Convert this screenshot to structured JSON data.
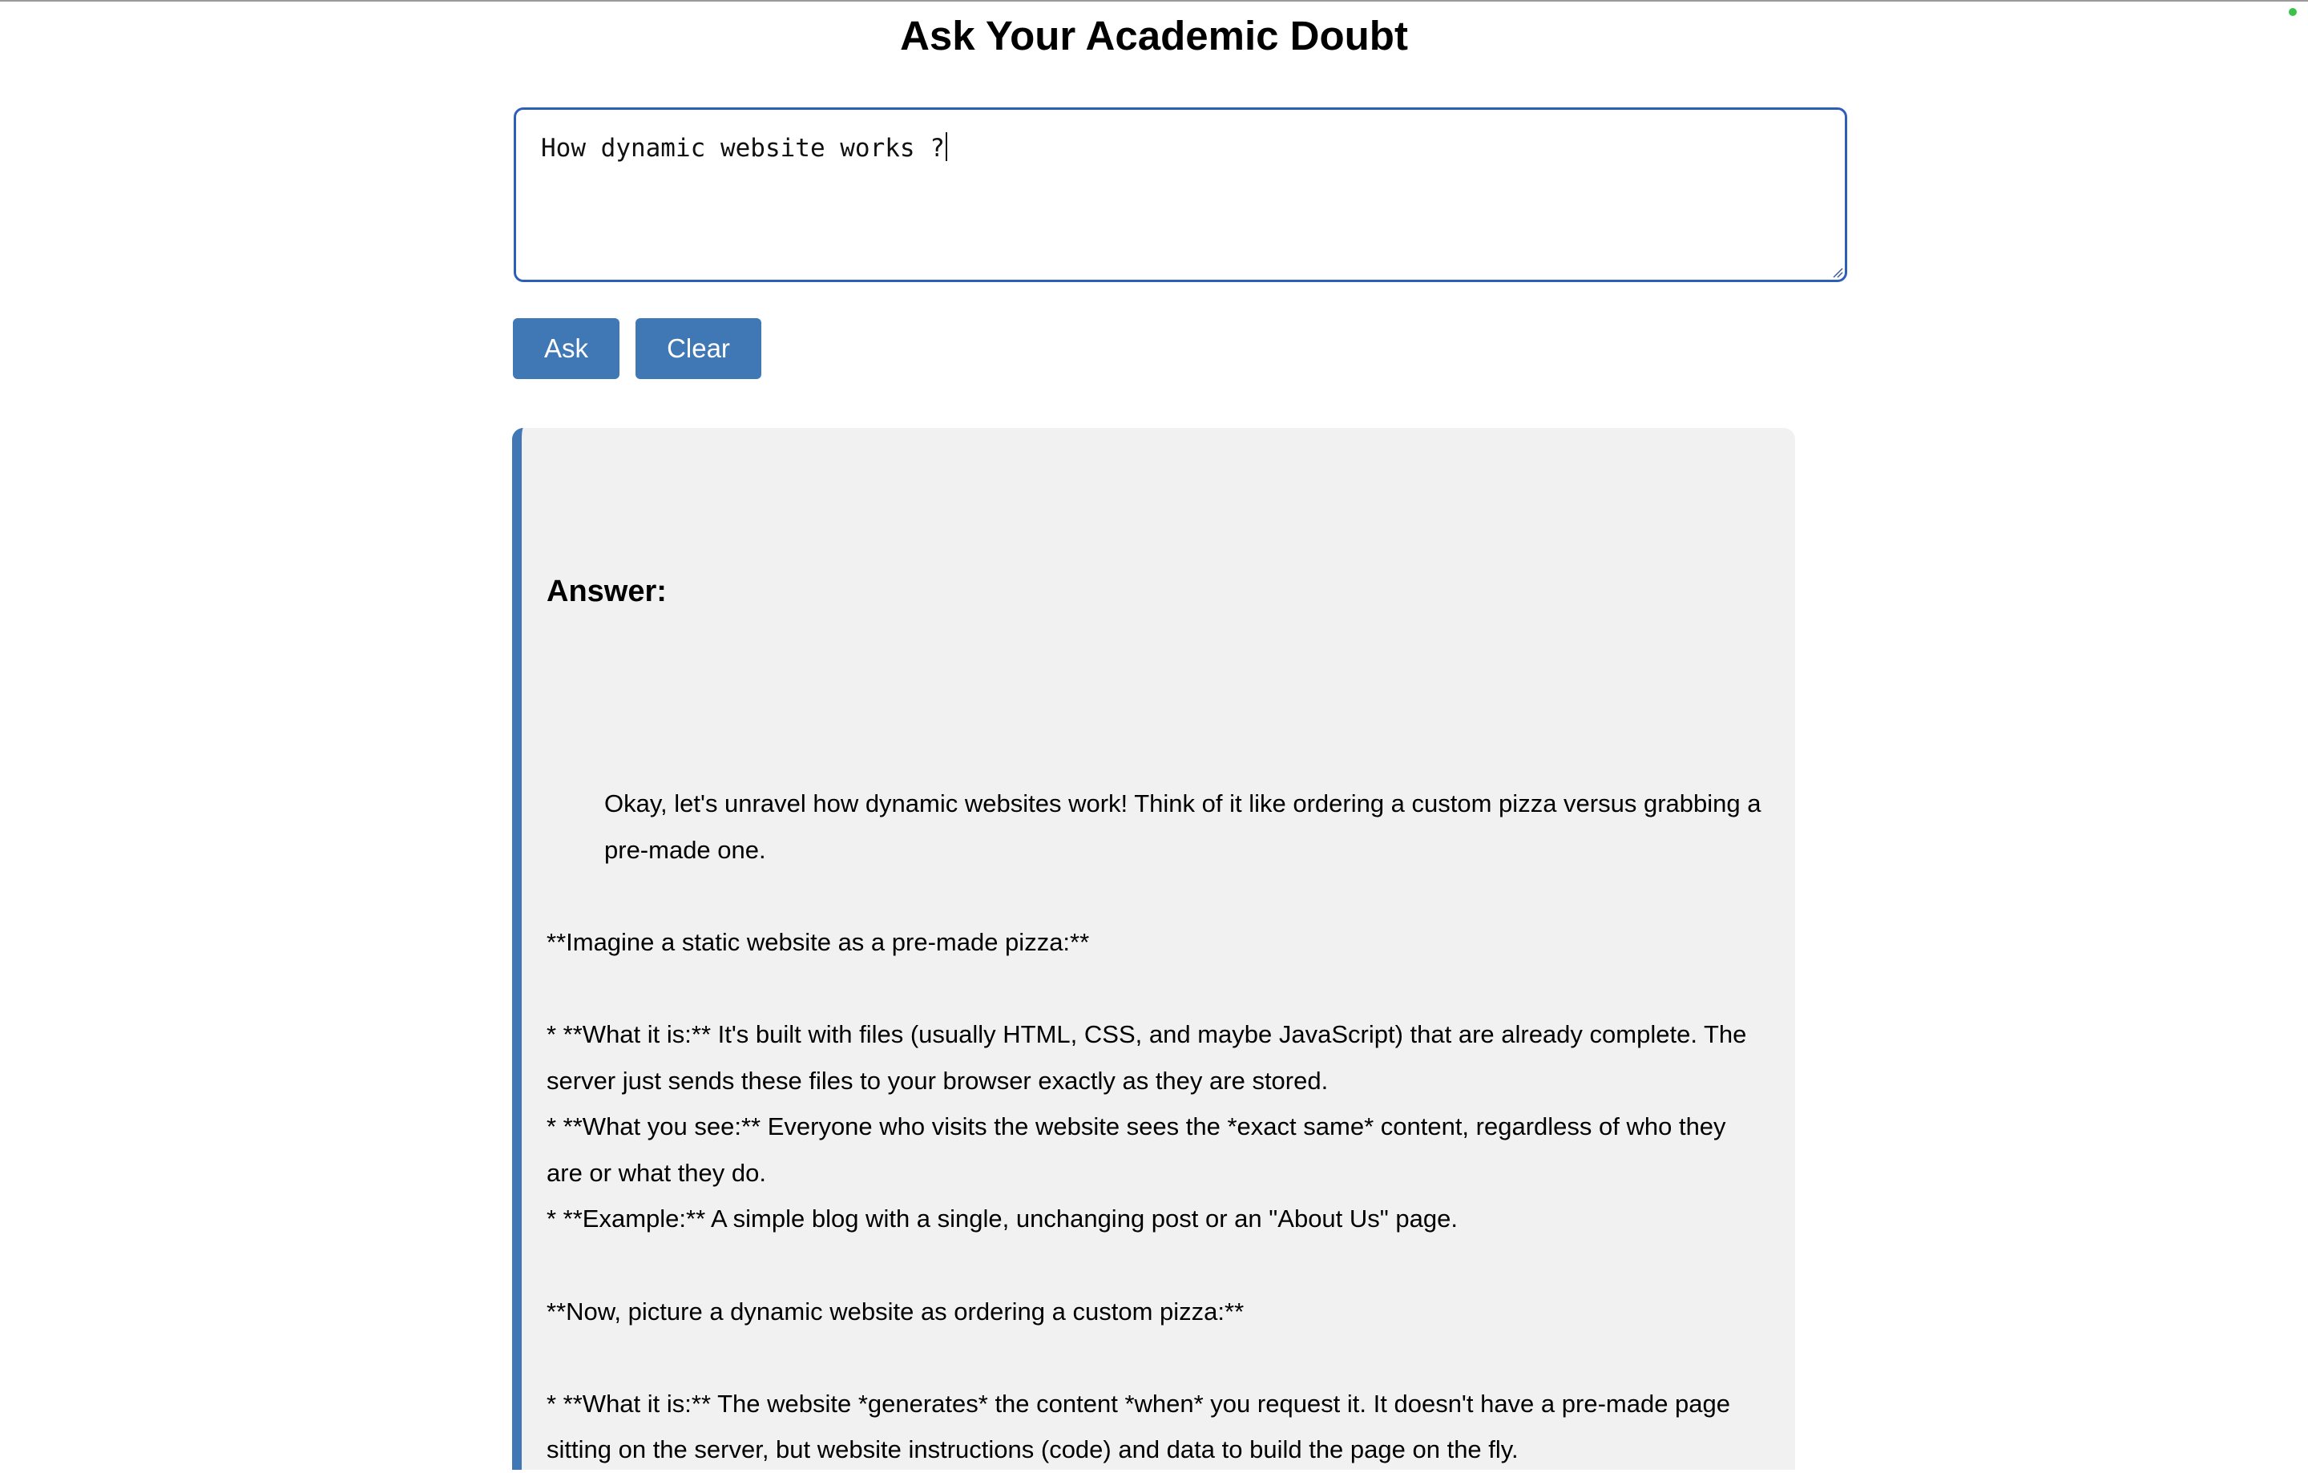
{
  "header": {
    "title": "Ask Your Academic Doubt"
  },
  "question": {
    "value": "How dynamic website works ?"
  },
  "buttons": {
    "ask_label": "Ask",
    "clear_label": "Clear"
  },
  "answer": {
    "heading": "Answer:",
    "lines": [
      "Okay, let's unravel how dynamic websites work! Think of it like ordering a custom pizza versus grabbing a pre-made one.",
      "**Imagine a static website as a pre-made pizza:**",
      "*   **What it is:** It's built with files (usually HTML, CSS, and maybe JavaScript) that are already complete. The server just sends these files to your browser exactly as they are stored.",
      "*   **What you see:** Everyone who visits the website sees the *exact same* content, regardless of who they are or what they do.",
      "*   **Example:** A simple blog with a single, unchanging post or an \"About Us\" page.",
      "**Now, picture a dynamic website as ordering a custom pizza:**",
      "*   **What it is:** The website *generates* the content *when* you request it. It doesn't have a pre-made page sitting on the server, but website instructions (code) and data to build the page on the fly."
    ]
  },
  "colors": {
    "accent": "#4078b6",
    "input_border": "#2e5fb8",
    "panel_bg": "#f1f1f1"
  }
}
